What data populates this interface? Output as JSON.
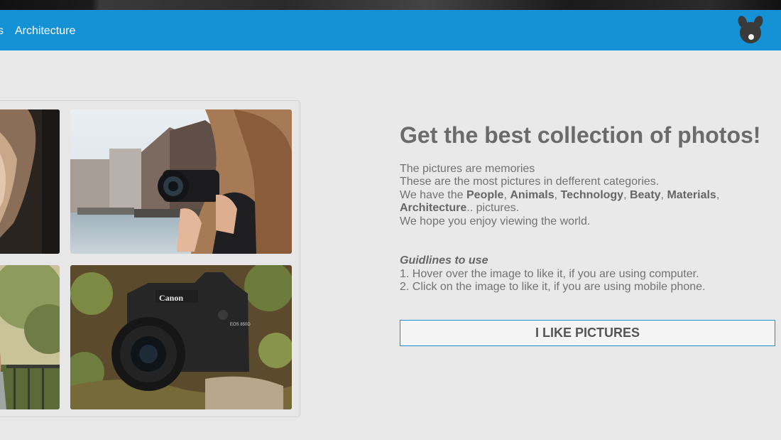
{
  "navbar": {
    "partial_prev_label": "s",
    "architecture_label": "Architecture",
    "brand_color": "#1592d5"
  },
  "logo": {
    "icon": "bear-face-icon"
  },
  "gallery": {
    "photos": [
      {
        "subject": "person-portrait-photo"
      },
      {
        "subject": "woman-with-camera-photo"
      },
      {
        "subject": "person-outdoors-photo"
      },
      {
        "subject": "canon-camera-photo"
      }
    ]
  },
  "main": {
    "headline": "Get the best collection of photos!",
    "line1": "The pictures are memories",
    "line2": "These are the most pictures in defferent categories.",
    "line3_prefix": "We have the ",
    "cat_people": "People",
    "cat_animals": "Animals",
    "cat_technology": "Technology",
    "cat_beaty": "Beaty",
    "cat_materials": "Materials",
    "cat_architecture": "Architecture",
    "sep": ", ",
    "line3_suffix": ".. pictures.",
    "line4": "We hope you enjoy viewing the world.",
    "guide_heading": "Guidlines to use",
    "guide1": "1. Hover over the image to like it, if you are using computer.",
    "guide2": "2. Click on the image to like it, if you are using mobile phone.",
    "button_label": "I LIKE PICTURES",
    "button_border_color": "#1a8fd0"
  },
  "camera_text": {
    "brand": "Canon",
    "model": "EOS 850D"
  }
}
